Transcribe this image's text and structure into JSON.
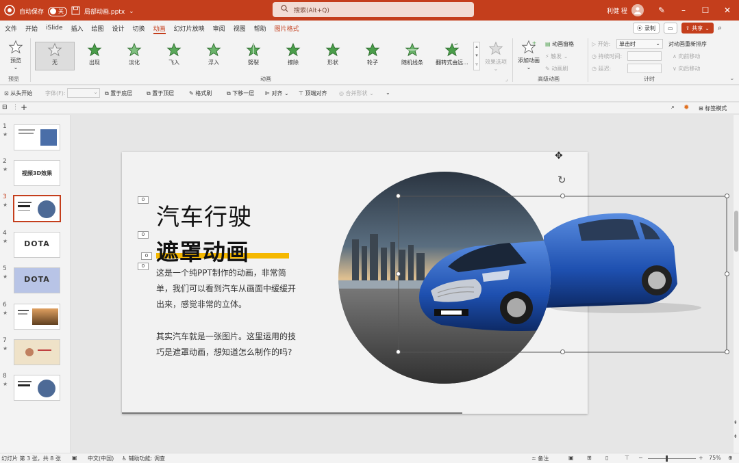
{
  "titlebar": {
    "autosave_label": "自动保存",
    "autosave_state": "关",
    "filename": "局部动画.pptx",
    "search_placeholder": "搜索(Alt+Q)",
    "user_name": "利健 程"
  },
  "menu": {
    "items": [
      "文件",
      "开始",
      "iSlide",
      "插入",
      "绘图",
      "设计",
      "切换",
      "动画",
      "幻灯片放映",
      "审阅",
      "视图",
      "帮助",
      "图片格式"
    ],
    "active": "动画",
    "record_label": "录制",
    "share_label": "共享"
  },
  "ribbon": {
    "preview_label": "预览",
    "preview_group": "预览",
    "animations": [
      "无",
      "出现",
      "淡化",
      "飞入",
      "浮入",
      "劈裂",
      "擦除",
      "形状",
      "轮子",
      "随机线条",
      "翻转式由远..."
    ],
    "effect_options": "效果选项",
    "animation_group": "动画",
    "add_animation": "添加动画",
    "animation_pane": "动画窗格",
    "trigger": "触发",
    "animation_painter": "动画刷",
    "advanced_group": "高级动画",
    "start_label": "开始:",
    "start_value": "单击时",
    "duration_label": "持续时间:",
    "delay_label": "延迟:",
    "timing_group": "计时",
    "reorder_label": "对动画重新排序",
    "move_earlier": "向前移动",
    "move_later": "向后移动"
  },
  "quickbar": {
    "from_start": "从头开始",
    "font_label": "字体(F):",
    "send_back": "置于底层",
    "bring_front": "置于顶层",
    "format_painter": "格式刷",
    "send_backward": "下移一层",
    "align": "对齐",
    "align_top": "顶端对齐",
    "merge_shapes": "合并形状"
  },
  "tabstrip": {
    "tab_mode": "标签模式"
  },
  "thumbnails": [
    {
      "num": "1",
      "star": "★"
    },
    {
      "num": "2",
      "star": "★",
      "text": "视频3D效果"
    },
    {
      "num": "3",
      "star": "★"
    },
    {
      "num": "4",
      "star": "★",
      "text": "DOTA"
    },
    {
      "num": "5",
      "star": "★",
      "text": "DOTA"
    },
    {
      "num": "6",
      "star": "★"
    },
    {
      "num": "7",
      "star": "★"
    },
    {
      "num": "8",
      "star": "★"
    }
  ],
  "selected_slide": "3",
  "slide": {
    "title": "汽车行驶",
    "subtitle": "遮罩动画",
    "para1": "这是一个纯PPT制作的动画，非常简单，我们可以看到汽车从画面中缓缓开出来，感觉非常的立体。",
    "para2": "其实汽车就是一张图片。这里运用的技巧是遮罩动画，想知道怎么制作的吗?",
    "anim_tags": [
      "0",
      "0",
      "0",
      "0"
    ],
    "accent_color": "#f5b800"
  },
  "status": {
    "slide_info": "幻灯片 第 3 张，共 8 张",
    "language": "中文(中国)",
    "accessibility": "辅助功能: 调查",
    "notes": "备注",
    "zoom": "75%"
  },
  "colors": {
    "brand": "#c43e1c"
  }
}
